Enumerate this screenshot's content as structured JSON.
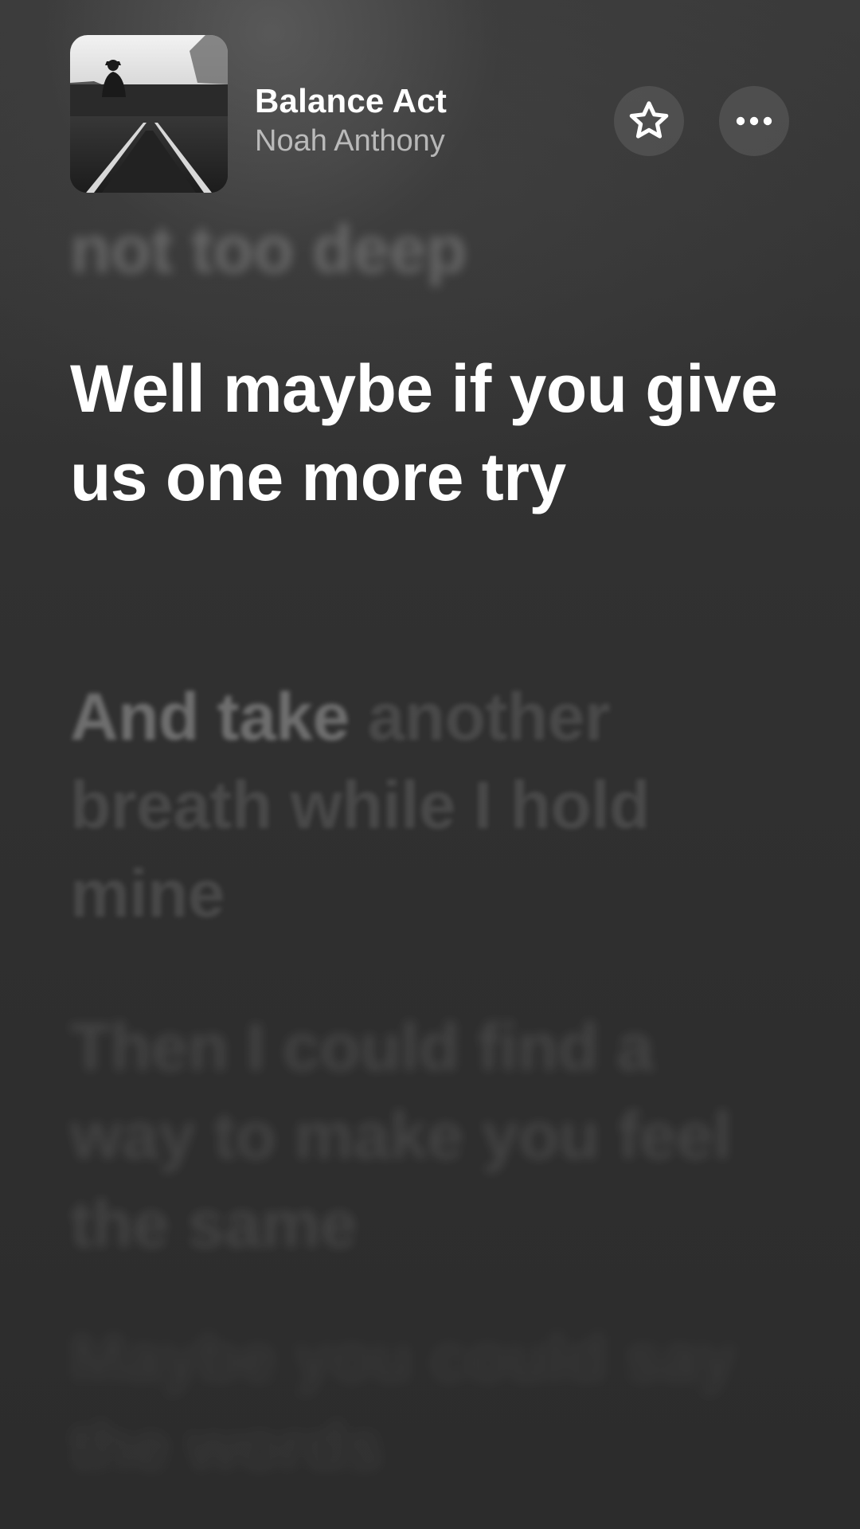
{
  "now_playing": {
    "title": "Balance Act",
    "artist": "Noah Anthony",
    "artwork_icon": "album-artwork"
  },
  "actions": {
    "favorite_icon": "star-icon",
    "more_icon": "ellipsis-icon"
  },
  "lyrics": {
    "previous_line": "not too deep",
    "current_line": "Well maybe if you give us one more try",
    "next_line_sung": "And take",
    "next_line_rest": "another breath while I hold mine",
    "upcoming_line": "Then I could find a way to make you feel the same",
    "faded_line": "Maybe you could say the words"
  },
  "colors": {
    "background": "#2f2f2f",
    "text_active": "#ffffff"
  }
}
